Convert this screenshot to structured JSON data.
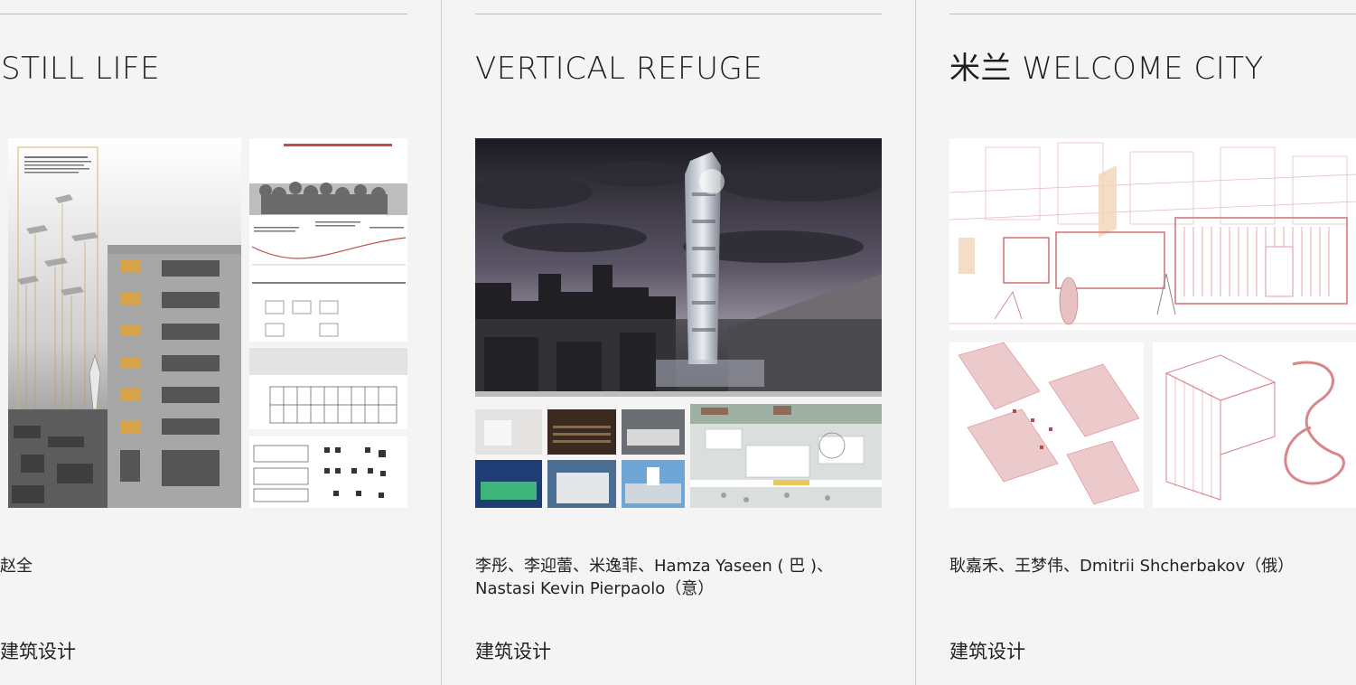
{
  "projects": [
    {
      "title": "STILL LIFE",
      "authors_line1": "赵全",
      "authors_line2": "",
      "category": "建筑设计"
    },
    {
      "title": "VERTICAL REFUGE",
      "authors_line1": "李彤、李迎蕾、米逸菲、Hamza Yaseen ( 巴 )、",
      "authors_line2": "Nastasi Kevin Pierpaolo（意）",
      "category": "建筑设计"
    },
    {
      "title": "米兰 WELCOME CITY",
      "authors_line1": "耿嘉禾、王梦伟、Dmitrii Shcherbakov（俄）",
      "authors_line2": "",
      "category": "建筑设计"
    }
  ],
  "colors": {
    "background": "#f4f4f4",
    "divider": "#cfcfcf",
    "text": "#222222",
    "accent_red": "#d9868a"
  }
}
